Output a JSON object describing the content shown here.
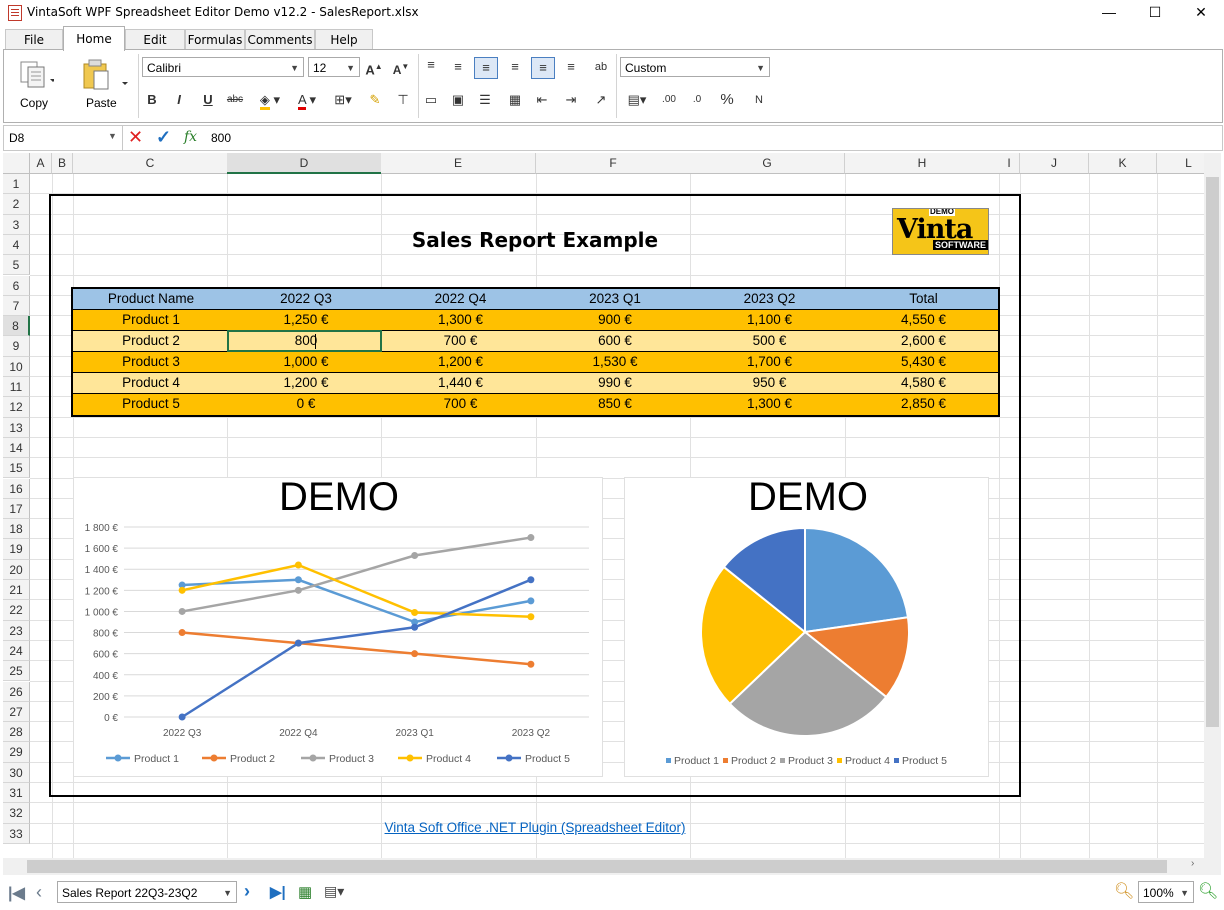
{
  "window": {
    "title": "VintaSoft WPF Spreadsheet Editor Demo v12.2 - SalesReport.xlsx",
    "minimize": "—",
    "maximize": "☐",
    "close": "✕"
  },
  "menu_tabs": [
    "File",
    "Home",
    "Edit",
    "Formulas",
    "Comments",
    "Help"
  ],
  "ribbon": {
    "copy_label": "Copy",
    "paste_label": "Paste",
    "font_name": "Calibri",
    "font_size": "12",
    "number_format": "Custom",
    "bold": "B",
    "italic": "I",
    "underline": "U",
    "strike": "abc",
    "percent": "%"
  },
  "formula_bar": {
    "cell_ref": "D8",
    "fx": "fx",
    "value": "800"
  },
  "columns": [
    "A",
    "B",
    "C",
    "D",
    "E",
    "F",
    "G",
    "H",
    "I",
    "J",
    "K",
    "L"
  ],
  "rows": [
    "1",
    "2",
    "3",
    "4",
    "5",
    "6",
    "7",
    "8",
    "9",
    "10",
    "11",
    "12",
    "13",
    "14",
    "15",
    "16",
    "17",
    "18",
    "19",
    "20",
    "21",
    "22",
    "23",
    "24",
    "25",
    "26",
    "27",
    "28",
    "29",
    "30",
    "31",
    "32",
    "33"
  ],
  "report": {
    "title": "Sales Report Example",
    "logo_top": "DEMO",
    "logo_main": "Vinta",
    "logo_sub": "SOFTWARE",
    "headers": [
      "Product Name",
      "2022 Q3",
      "2022 Q4",
      "2023 Q1",
      "2023 Q2",
      "Total"
    ],
    "rows": [
      [
        "Product 1",
        "1,250 €",
        "1,300 €",
        "900 €",
        "1,100 €",
        "4,550 €"
      ],
      [
        "Product 2",
        "800",
        "700 €",
        "600 €",
        "500 €",
        "2,600 €"
      ],
      [
        "Product 3",
        "1,000 €",
        "1,200 €",
        "1,530 €",
        "1,700 €",
        "5,430 €"
      ],
      [
        "Product 4",
        "1,200 €",
        "1,440 €",
        "990 €",
        "950 €",
        "4,580 €"
      ],
      [
        "Product 5",
        "0 €",
        "700 €",
        "850 €",
        "1,300 €",
        "2,850 €"
      ]
    ],
    "link": "Vinta Soft Office .NET Plugin (Spreadsheet Editor)"
  },
  "colors": {
    "header_blue": "#9dc3e6",
    "row_orange": "#ffc000",
    "row_light": "#ffe699",
    "series": [
      "#5b9bd5",
      "#ed7d31",
      "#a5a5a5",
      "#ffc000",
      "#4472c4"
    ]
  },
  "chart_data": [
    {
      "type": "line",
      "watermark": "DEMO",
      "categories": [
        "2022 Q3",
        "2022 Q4",
        "2023 Q1",
        "2023 Q2"
      ],
      "ytick_labels": [
        "0 €",
        "200 €",
        "400 €",
        "600 €",
        "800 €",
        "1 000 €",
        "1 200 €",
        "1 400 €",
        "1 600 €",
        "1 800 €"
      ],
      "ylim": [
        0,
        1800
      ],
      "grid": true,
      "legend": "bottom",
      "series": [
        {
          "name": "Product 1",
          "values": [
            1250,
            1300,
            900,
            1100
          ]
        },
        {
          "name": "Product 2",
          "values": [
            800,
            700,
            600,
            500
          ]
        },
        {
          "name": "Product 3",
          "values": [
            1000,
            1200,
            1530,
            1700
          ]
        },
        {
          "name": "Product 4",
          "values": [
            1200,
            1440,
            990,
            950
          ]
        },
        {
          "name": "Product 5",
          "values": [
            0,
            700,
            850,
            1300
          ]
        }
      ]
    },
    {
      "type": "pie",
      "watermark": "DEMO",
      "legend": "bottom",
      "categories": [
        "Product 1",
        "Product 2",
        "Product 3",
        "Product 4",
        "Product 5"
      ],
      "values": [
        4550,
        2600,
        5430,
        4580,
        2850
      ]
    }
  ],
  "sheet_bar": {
    "sheet_name": "Sales Report 22Q3-23Q2",
    "zoom": "100%"
  }
}
